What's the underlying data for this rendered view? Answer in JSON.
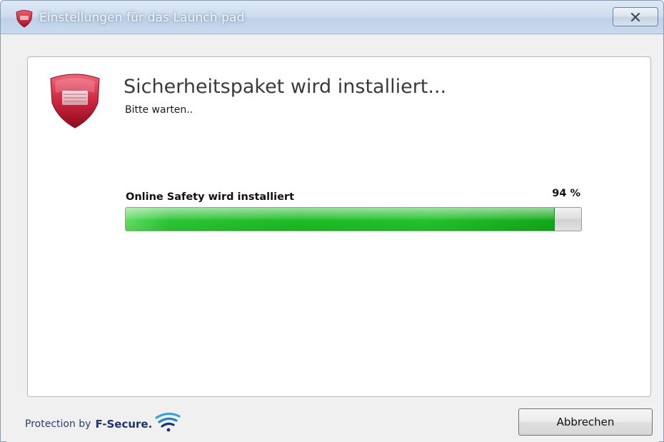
{
  "window": {
    "title": "Einstellungen für das Launch pad",
    "close_icon": "close-icon"
  },
  "main": {
    "logo_icon": "shield-icon",
    "heading": "Sicherheitspaket wird installiert...",
    "subtext": "Bitte warten..",
    "progress": {
      "label": "Online Safety wird installiert",
      "percent_text": "94 %",
      "value": 94
    }
  },
  "footer": {
    "brand_prefix": "Protection by",
    "brand_name": "F-Secure.",
    "brand_icon": "wifi-waves-icon",
    "cancel_label": "Abbrechen"
  },
  "colors": {
    "progress_green": "#1cbb24",
    "shield_red": "#c8243a",
    "brand_blue": "#1f3569"
  }
}
